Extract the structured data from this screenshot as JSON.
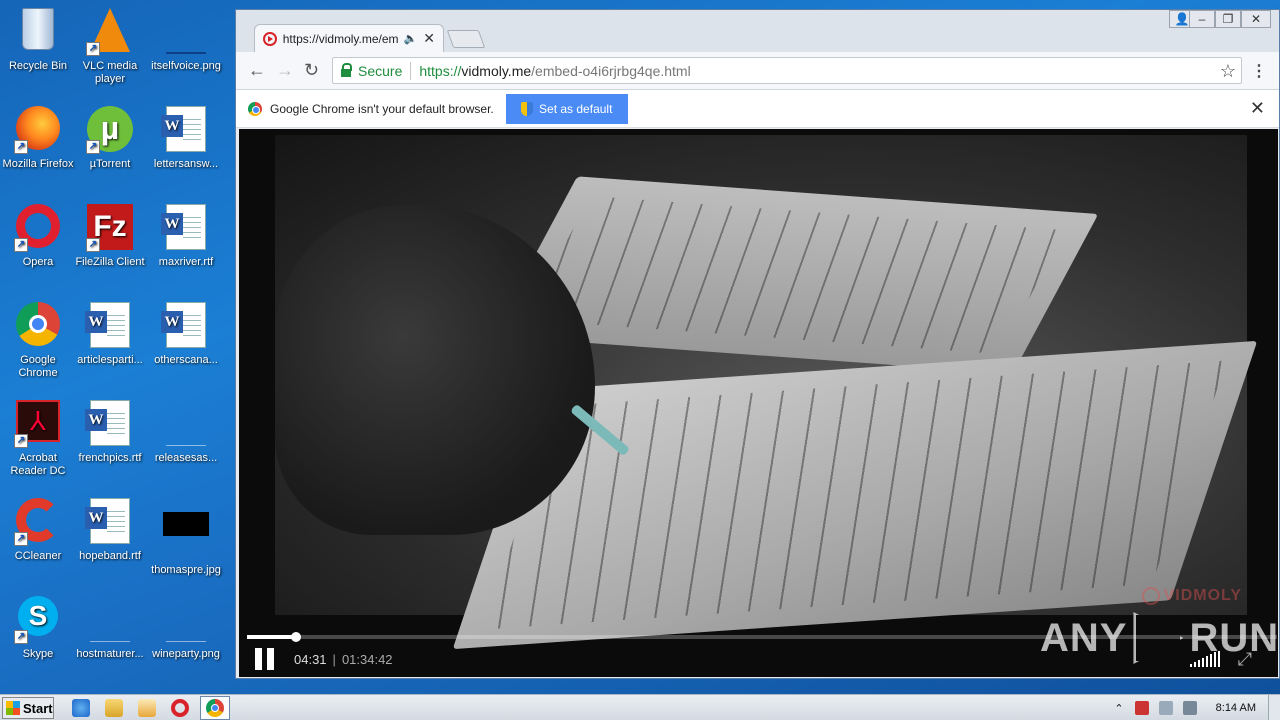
{
  "desktop": {
    "icons": [
      {
        "label": "Recycle Bin"
      },
      {
        "label": "VLC media player"
      },
      {
        "label": "itselfvoice.png"
      },
      {
        "label": "Mozilla Firefox"
      },
      {
        "label": "µTorrent"
      },
      {
        "label": "lettersansw..."
      },
      {
        "label": "Opera"
      },
      {
        "label": "FileZilla Client"
      },
      {
        "label": "maxriver.rtf"
      },
      {
        "label": "Google Chrome"
      },
      {
        "label": "articlesparti..."
      },
      {
        "label": "otherscana..."
      },
      {
        "label": "Acrobat Reader DC"
      },
      {
        "label": "frenchpics.rtf"
      },
      {
        "label": "releasesas..."
      },
      {
        "label": "CCleaner"
      },
      {
        "label": "hopeband.rtf"
      },
      {
        "label": "thomaspre.jpg"
      },
      {
        "label": "Skype"
      },
      {
        "label": "hostmaturer..."
      },
      {
        "label": "wineparty.png"
      }
    ]
  },
  "browser": {
    "tab": {
      "title": "https://vidmoly.me/emb"
    },
    "address": {
      "secure_label": "Secure",
      "scheme": "https://",
      "host": "vidmoly.me",
      "path": "/embed-o4i6rjrbg4qe.html"
    },
    "infobar": {
      "message": "Google Chrome isn't your default browser.",
      "button_label": "Set as default"
    }
  },
  "video": {
    "brand": "VIDMOLY",
    "current_time": "04:31",
    "separator": "|",
    "duration": "01:34:42",
    "progress": 0.048
  },
  "watermark": {
    "left": "ANY",
    "right": "RUN"
  },
  "taskbar": {
    "start_label": "Start",
    "clock": "8:14 AM"
  },
  "colors": {
    "secure_green": "#1e8e3e",
    "button_blue": "#4a8bf5",
    "desktop_blue": "#1b7fd4"
  }
}
